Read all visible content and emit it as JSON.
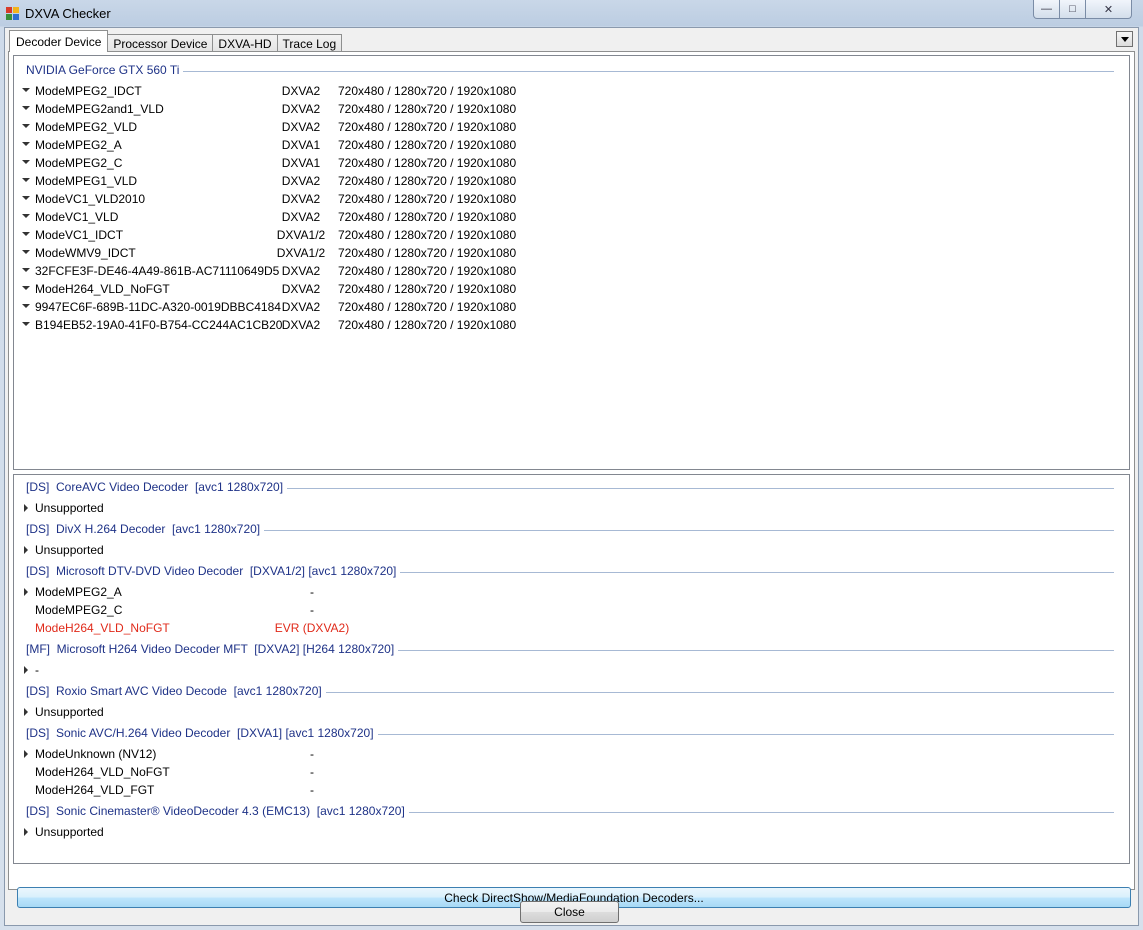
{
  "window": {
    "title": "DXVA Checker",
    "controls": {
      "minimize": "—",
      "maximize": "□",
      "close": "✕"
    }
  },
  "tabs": [
    {
      "label": "Decoder Device",
      "active": true
    },
    {
      "label": "Processor Device",
      "active": false
    },
    {
      "label": "DXVA-HD",
      "active": false
    },
    {
      "label": "Trace Log",
      "active": false
    }
  ],
  "colors": {
    "group_header": "#1e3287",
    "highlight_row": "#e02a1a",
    "group_line": "#a7b9d4"
  },
  "decoder_device": {
    "gpu_name": "NVIDIA GeForce GTX 560 Ti",
    "modes": [
      {
        "name": "ModeMPEG2_IDCT",
        "api": "DXVA2",
        "resolutions": "720x480 / 1280x720 / 1920x1080"
      },
      {
        "name": "ModeMPEG2and1_VLD",
        "api": "DXVA2",
        "resolutions": "720x480 / 1280x720 / 1920x1080"
      },
      {
        "name": "ModeMPEG2_VLD",
        "api": "DXVA2",
        "resolutions": "720x480 / 1280x720 / 1920x1080"
      },
      {
        "name": "ModeMPEG2_A",
        "api": "DXVA1",
        "resolutions": "720x480 / 1280x720 / 1920x1080"
      },
      {
        "name": "ModeMPEG2_C",
        "api": "DXVA1",
        "resolutions": "720x480 / 1280x720 / 1920x1080"
      },
      {
        "name": "ModeMPEG1_VLD",
        "api": "DXVA2",
        "resolutions": "720x480 / 1280x720 / 1920x1080"
      },
      {
        "name": "ModeVC1_VLD2010",
        "api": "DXVA2",
        "resolutions": "720x480 / 1280x720 / 1920x1080"
      },
      {
        "name": "ModeVC1_VLD",
        "api": "DXVA2",
        "resolutions": "720x480 / 1280x720 / 1920x1080"
      },
      {
        "name": "ModeVC1_IDCT",
        "api": "DXVA1/2",
        "resolutions": "720x480 / 1280x720 / 1920x1080"
      },
      {
        "name": "ModeWMV9_IDCT",
        "api": "DXVA1/2",
        "resolutions": "720x480 / 1280x720 / 1920x1080"
      },
      {
        "name": "32FCFE3F-DE46-4A49-861B-AC71110649D5",
        "api": "DXVA2",
        "resolutions": "720x480 / 1280x720 / 1920x1080"
      },
      {
        "name": "ModeH264_VLD_NoFGT",
        "api": "DXVA2",
        "resolutions": "720x480 / 1280x720 / 1920x1080"
      },
      {
        "name": "9947EC6F-689B-11DC-A320-0019DBBC4184",
        "api": "DXVA2",
        "resolutions": "720x480 / 1280x720 / 1920x1080"
      },
      {
        "name": "B194EB52-19A0-41F0-B754-CC244AC1CB20",
        "api": "DXVA2",
        "resolutions": "720x480 / 1280x720 / 1920x1080"
      }
    ]
  },
  "decoders": [
    {
      "header": "[DS]  CoreAVC Video Decoder  [avc1 1280x720]",
      "rows": [
        {
          "arrow": "right",
          "name": "Unsupported",
          "value": "",
          "highlight": false
        }
      ]
    },
    {
      "header": "[DS]  DivX H.264 Decoder  [avc1 1280x720]",
      "rows": [
        {
          "arrow": "right",
          "name": "Unsupported",
          "value": "",
          "highlight": false
        }
      ]
    },
    {
      "header": "[DS]  Microsoft DTV-DVD Video Decoder  [DXVA1/2] [avc1 1280x720]",
      "rows": [
        {
          "arrow": "right",
          "name": "ModeMPEG2_A",
          "value": "-",
          "highlight": false
        },
        {
          "arrow": "none",
          "name": "ModeMPEG2_C",
          "value": "-",
          "highlight": false
        },
        {
          "arrow": "none",
          "name": "ModeH264_VLD_NoFGT",
          "value": "EVR (DXVA2)",
          "highlight": true
        }
      ]
    },
    {
      "header": "[MF]  Microsoft H264 Video Decoder MFT  [DXVA2] [H264 1280x720]",
      "rows": [
        {
          "arrow": "right",
          "name": "-",
          "value": "",
          "highlight": false
        }
      ]
    },
    {
      "header": "[DS]  Roxio Smart AVC Video Decode  [avc1 1280x720]",
      "rows": [
        {
          "arrow": "right",
          "name": "Unsupported",
          "value": "",
          "highlight": false
        }
      ]
    },
    {
      "header": "[DS]  Sonic AVC/H.264 Video Decoder  [DXVA1] [avc1 1280x720]",
      "rows": [
        {
          "arrow": "right",
          "name": "ModeUnknown (NV12)",
          "value": "-",
          "highlight": false
        },
        {
          "arrow": "none",
          "name": "ModeH264_VLD_NoFGT",
          "value": "-",
          "highlight": false
        },
        {
          "arrow": "none",
          "name": "ModeH264_VLD_FGT",
          "value": "-",
          "highlight": false
        }
      ]
    },
    {
      "header": "[DS]  Sonic Cinemaster® VideoDecoder 4.3 (EMC13)  [avc1 1280x720]",
      "rows": [
        {
          "arrow": "right",
          "name": "Unsupported",
          "value": "",
          "highlight": false
        }
      ]
    }
  ],
  "buttons": {
    "check": "Check DirectShow/MediaFoundation Decoders...",
    "close": "Close"
  }
}
